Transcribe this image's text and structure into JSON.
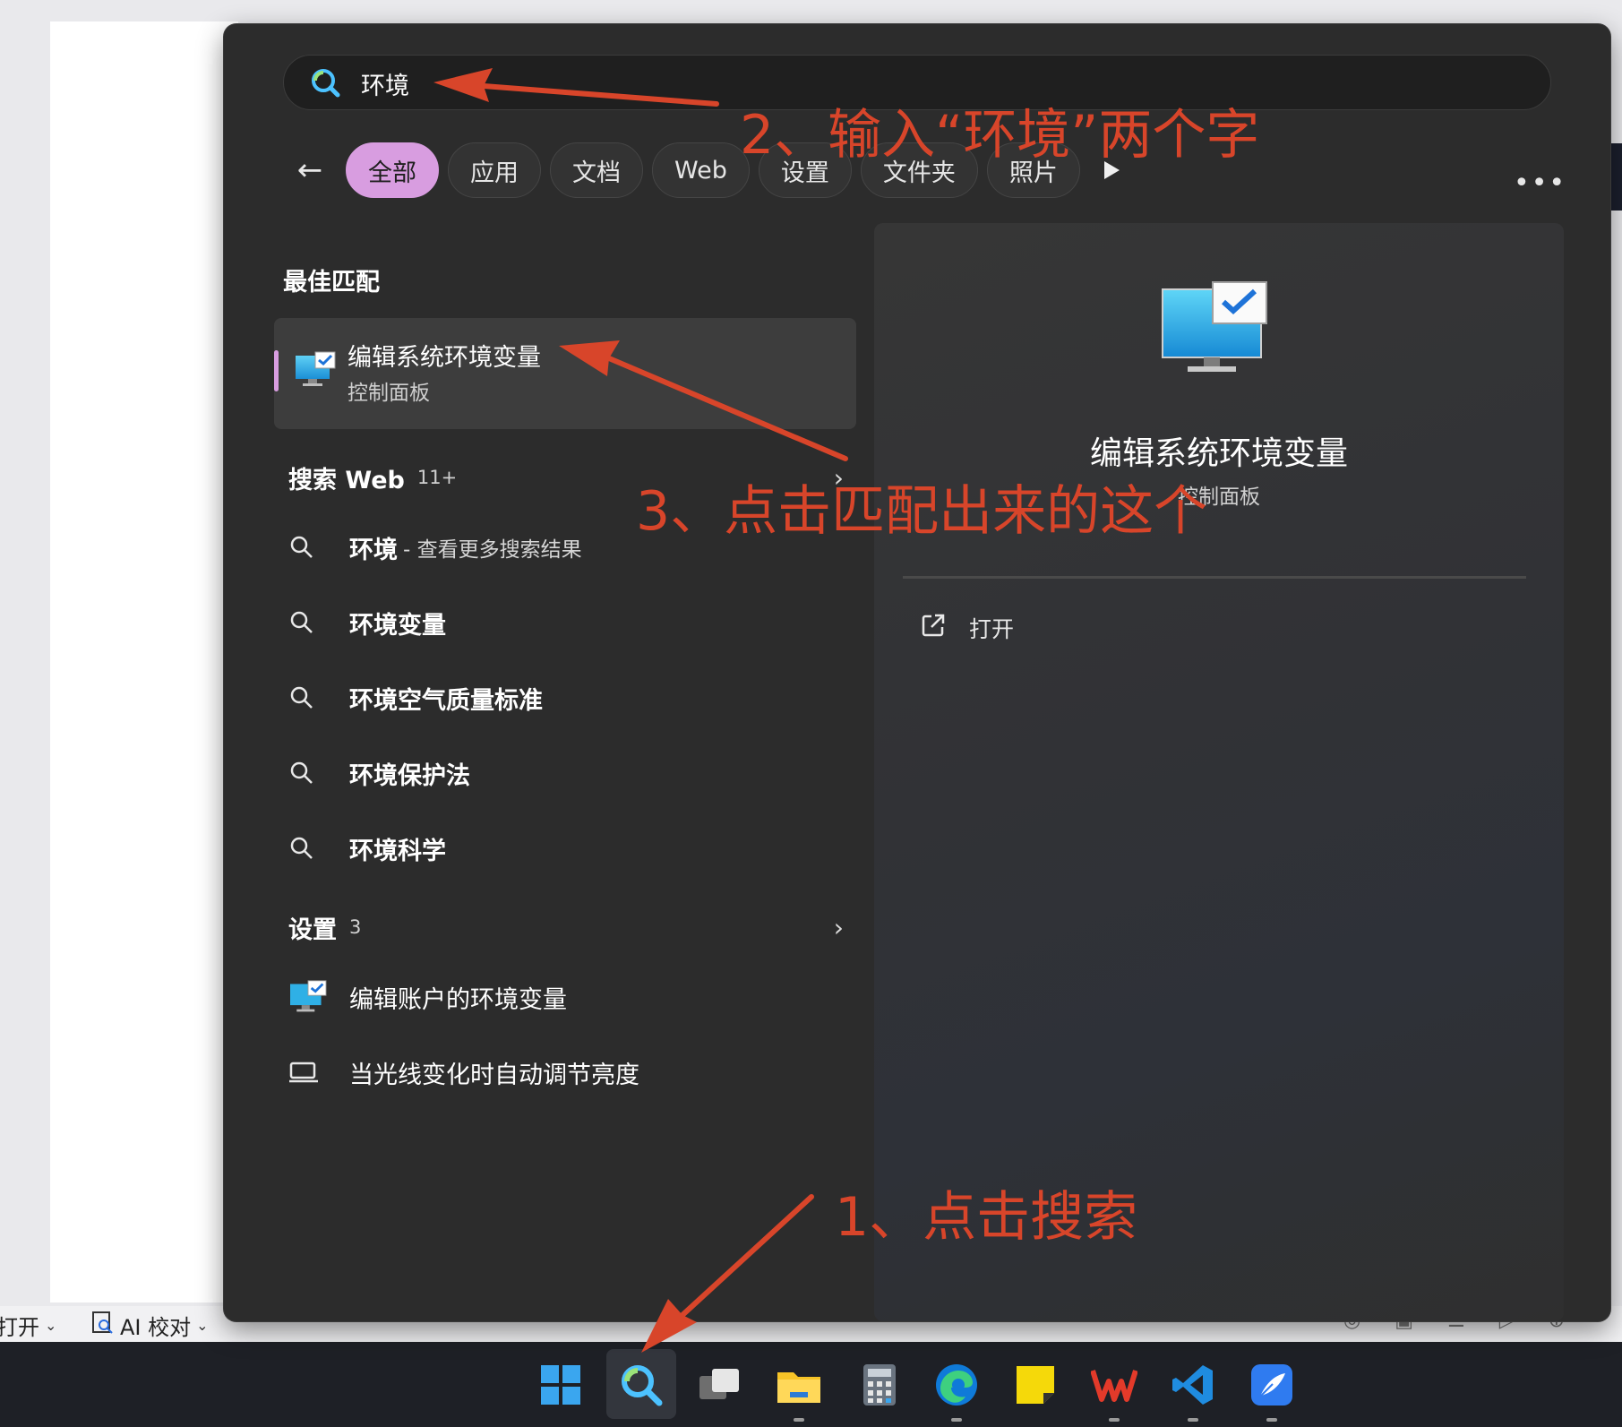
{
  "background": {
    "status_bar": {
      "left_label": "打开",
      "ai_label": "AI 校对"
    }
  },
  "search": {
    "query": "环境",
    "filters": [
      "全部",
      "应用",
      "文档",
      "Web",
      "设置",
      "文件夹",
      "照片"
    ],
    "active_filter": "全部"
  },
  "best_match": {
    "heading": "最佳匹配",
    "title": "编辑系统环境变量",
    "subtitle": "控制面板"
  },
  "web_section": {
    "heading": "搜索 Web",
    "count": "11+",
    "items": [
      {
        "text": "环境",
        "sub": "- 查看更多搜索结果"
      },
      {
        "text": "环境变量",
        "sub": ""
      },
      {
        "text": "环境空气质量标准",
        "sub": ""
      },
      {
        "text": "环境保护法",
        "sub": ""
      },
      {
        "text": "环境科学",
        "sub": ""
      }
    ]
  },
  "settings_section": {
    "heading": "设置",
    "count": "3",
    "items": [
      {
        "text": "编辑账户的环境变量"
      },
      {
        "text": "当光线变化时自动调节亮度"
      }
    ]
  },
  "preview": {
    "title": "编辑系统环境变量",
    "subtitle": "控制面板",
    "open_label": "打开"
  },
  "annotations": {
    "step1": "1、点击搜索",
    "step2": "2、输入“环境”两个字",
    "step3": "3、点击匹配出来的这个"
  },
  "colors": {
    "accent": "#d89de0",
    "panel": "#2c2c2c",
    "annotation": "#d8452a",
    "taskbar": "#1e2026"
  }
}
